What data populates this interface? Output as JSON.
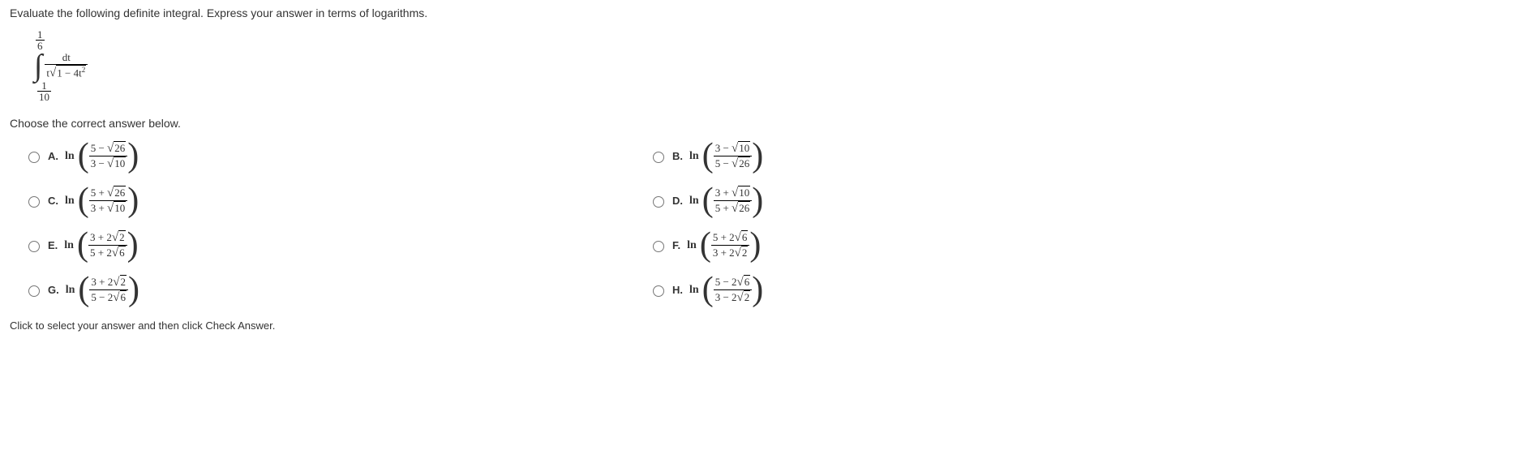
{
  "question": "Evaluate the following definite integral. Express your answer in terms of logarithms.",
  "integral": {
    "upper_num": "1",
    "upper_den": "6",
    "lower_num": "1",
    "lower_den": "10",
    "integrand_num": "dt",
    "integrand_den_prefix": "t",
    "integrand_radicand": "1 − 4t",
    "integrand_exp": "2"
  },
  "choose_text": "Choose the correct answer below.",
  "choices": {
    "A": {
      "label": "A.",
      "num_a": "5 −",
      "num_rad": "26",
      "den_a": "3 −",
      "den_rad": "10"
    },
    "B": {
      "label": "B.",
      "num_a": "3 −",
      "num_rad": "10",
      "den_a": "5 −",
      "den_rad": "26"
    },
    "C": {
      "label": "C.",
      "num_a": "5 +",
      "num_rad": "26",
      "den_a": "3 +",
      "den_rad": "10"
    },
    "D": {
      "label": "D.",
      "num_a": "3 +",
      "num_rad": "10",
      "den_a": "5 +",
      "den_rad": "26"
    },
    "E": {
      "label": "E.",
      "num_a": "3 + 2",
      "num_rad": "2",
      "den_a": "5 + 2",
      "den_rad": "6"
    },
    "F": {
      "label": "F.",
      "num_a": "5 + 2",
      "num_rad": "6",
      "den_a": "3 + 2",
      "den_rad": "2"
    },
    "G": {
      "label": "G.",
      "num_a": "3 + 2",
      "num_rad": "2",
      "den_a": "5 − 2",
      "den_rad": "6"
    },
    "H": {
      "label": "H.",
      "num_a": "5 − 2",
      "num_rad": "6",
      "den_a": "3 − 2",
      "den_rad": "2"
    }
  },
  "ln": "ln",
  "click_text": "Click to select your answer and then click Check Answer."
}
